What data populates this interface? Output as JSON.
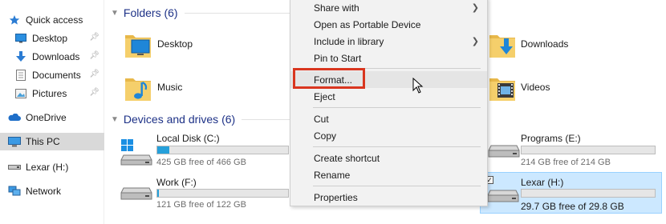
{
  "sidebar": {
    "quick_access": "Quick access",
    "items": [
      {
        "label": "Desktop",
        "icon": "desktop-icon"
      },
      {
        "label": "Downloads",
        "icon": "download-arrow-icon"
      },
      {
        "label": "Documents",
        "icon": "document-icon"
      },
      {
        "label": "Pictures",
        "icon": "pictures-icon"
      }
    ],
    "onedrive": "OneDrive",
    "this_pc": "This PC",
    "lexar": "Lexar (H:)",
    "network": "Network"
  },
  "folders": {
    "header": "Folders (6)",
    "items": [
      {
        "label": "Desktop",
        "icon": "desktop-folder-icon"
      },
      {
        "label": "Music",
        "icon": "music-folder-icon"
      },
      {
        "label": "Downloads",
        "icon": "downloads-folder-icon"
      },
      {
        "label": "Videos",
        "icon": "videos-folder-icon"
      }
    ]
  },
  "drives": {
    "header": "Devices and drives (6)",
    "items": [
      {
        "label": "Local Disk (C:)",
        "free": "425 GB free of 466 GB",
        "used_fraction": 0.09
      },
      {
        "label": "Work (F:)",
        "free": "121 GB free of 122 GB",
        "used_fraction": 0.01
      },
      {
        "label": "Programs (E:)",
        "free": "214 GB free of 214 GB",
        "used_fraction": 0.0
      },
      {
        "label": "Lexar (H:)",
        "free": "29.7 GB free of 29.8 GB",
        "used_fraction": 0.0
      }
    ]
  },
  "context_menu": {
    "items": [
      {
        "label": "Share with",
        "submenu": true
      },
      {
        "label": "Open as Portable Device"
      },
      {
        "label": "Include in library",
        "submenu": true
      },
      {
        "label": "Pin to Start"
      },
      {
        "label": "Format..."
      },
      {
        "label": "Eject"
      },
      {
        "label": "Cut"
      },
      {
        "label": "Copy"
      },
      {
        "label": "Create shortcut"
      },
      {
        "label": "Rename"
      },
      {
        "label": "Properties"
      }
    ]
  },
  "colors": {
    "accent": "#26a0da",
    "header_text": "#1e3287",
    "highlight_box": "#d9361f",
    "selection": "#cce8ff"
  }
}
